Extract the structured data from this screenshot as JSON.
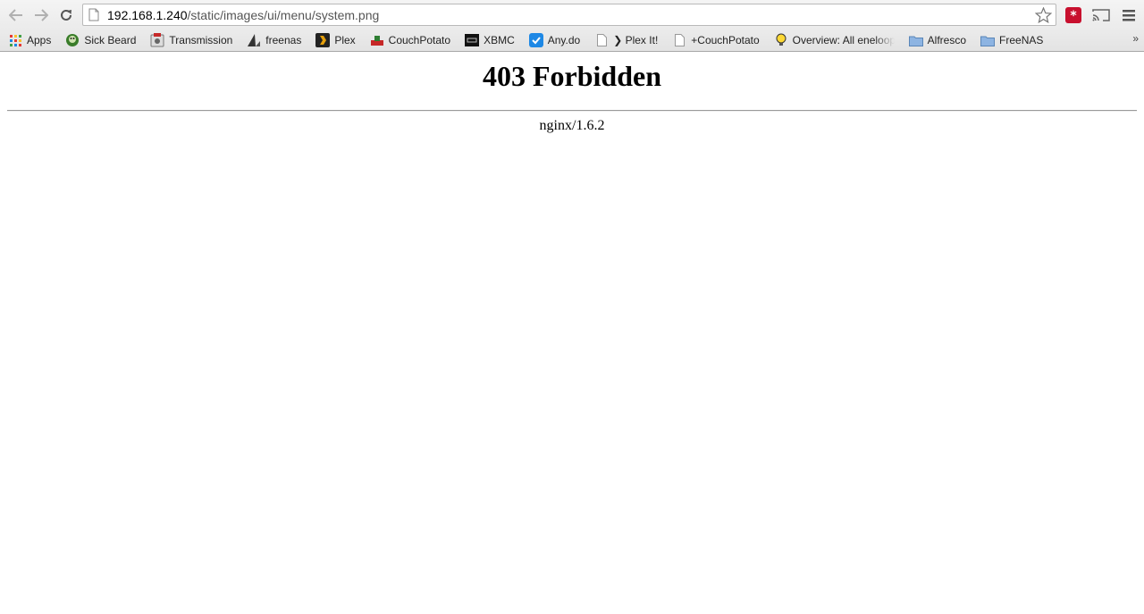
{
  "browser": {
    "url": {
      "host": "192.168.1.240",
      "path": "/static/images/ui/menu/system.png"
    },
    "bookmarks": [
      {
        "label": "Apps",
        "icon": "apps-grid-icon"
      },
      {
        "label": "Sick Beard",
        "icon": "sick-beard-icon"
      },
      {
        "label": "Transmission",
        "icon": "transmission-icon"
      },
      {
        "label": "freenas",
        "icon": "freenas-shark-icon"
      },
      {
        "label": "Plex",
        "icon": "plex-icon"
      },
      {
        "label": "CouchPotato",
        "icon": "couchpotato-icon"
      },
      {
        "label": "XBMC",
        "icon": "xbmc-icon"
      },
      {
        "label": "Any.do",
        "icon": "anydo-icon"
      },
      {
        "label": "❯ Plex It!",
        "icon": "page-icon"
      },
      {
        "label": "+CouchPotato",
        "icon": "page-icon"
      },
      {
        "label": "Overview: All eneloop",
        "icon": "lightbulb-icon"
      },
      {
        "label": "Alfresco",
        "icon": "folder-icon"
      },
      {
        "label": "FreeNAS",
        "icon": "folder-icon"
      }
    ],
    "overflow": "»"
  },
  "page": {
    "title": "403 Forbidden",
    "server": "nginx/1.6.2"
  },
  "colors": {
    "lastpass": "#c8102e",
    "plex": "#e5a00d",
    "anydo": "#1e88e5",
    "folder": "#8db4e2"
  }
}
